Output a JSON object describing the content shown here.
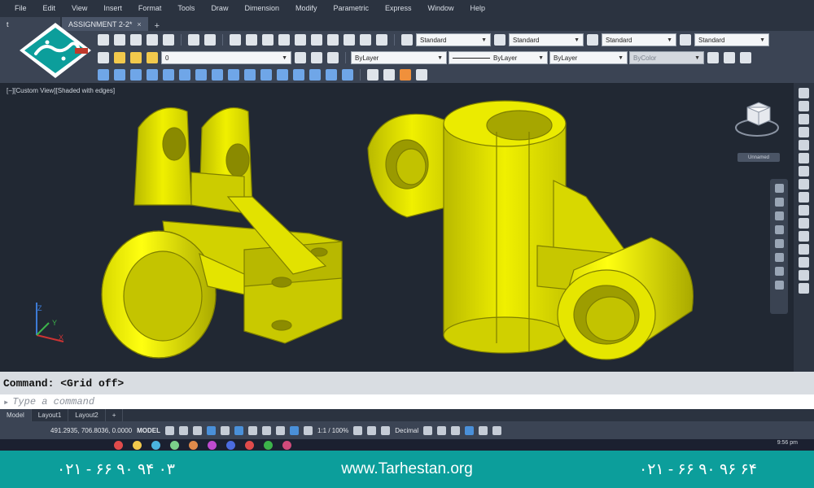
{
  "menu": [
    "File",
    "Edit",
    "View",
    "Insert",
    "Format",
    "Tools",
    "Draw",
    "Dimension",
    "Modify",
    "Parametric",
    "Express",
    "Window",
    "Help"
  ],
  "tabs": {
    "left_fragment": "t",
    "active": "ASSIGNMENT 2-2*",
    "close": "×",
    "add": "+"
  },
  "toolbar1": {
    "text_style": "Standard",
    "dim_style": "Standard",
    "table_style": "Standard",
    "mleader_style": "Standard"
  },
  "toolbar2": {
    "layer": "0",
    "color": "ByLayer",
    "linetype": "ByLayer",
    "lineweight": "ByLayer",
    "plot_style": "ByColor"
  },
  "viewport": {
    "label": "[−][Custom View][Shaded with edges]",
    "viewcube_label": "Unnamed"
  },
  "colors": {
    "accent": "#0c9e9b",
    "model": "#ffff00",
    "model_edge": "#8a8a00",
    "viewport_bg": "#212833"
  },
  "command": {
    "history": "Command:  <Grid off>",
    "placeholder": "Type a command"
  },
  "layout_tabs": [
    "Model",
    "Layout1",
    "Layout2",
    "+"
  ],
  "status": {
    "coords": "491.2935, 706.8036, 0.0000",
    "mode": "MODEL",
    "scale": "1:1 / 100%",
    "units": "Decimal"
  },
  "taskbar": {
    "clock": "9:56 pm"
  },
  "footer": {
    "phone_left": "۰۲۱ - ۶۶ ۹۰ ۹۴ ۰۳",
    "website": "www.Tarhestan.org",
    "phone_right": "۰۲۱ - ۶۶ ۹۰ ۹۶ ۶۴"
  },
  "icons": [
    "logo-mark",
    "ucs-axis-icon",
    "viewcube-icon",
    "close-icon",
    "plus-icon"
  ]
}
